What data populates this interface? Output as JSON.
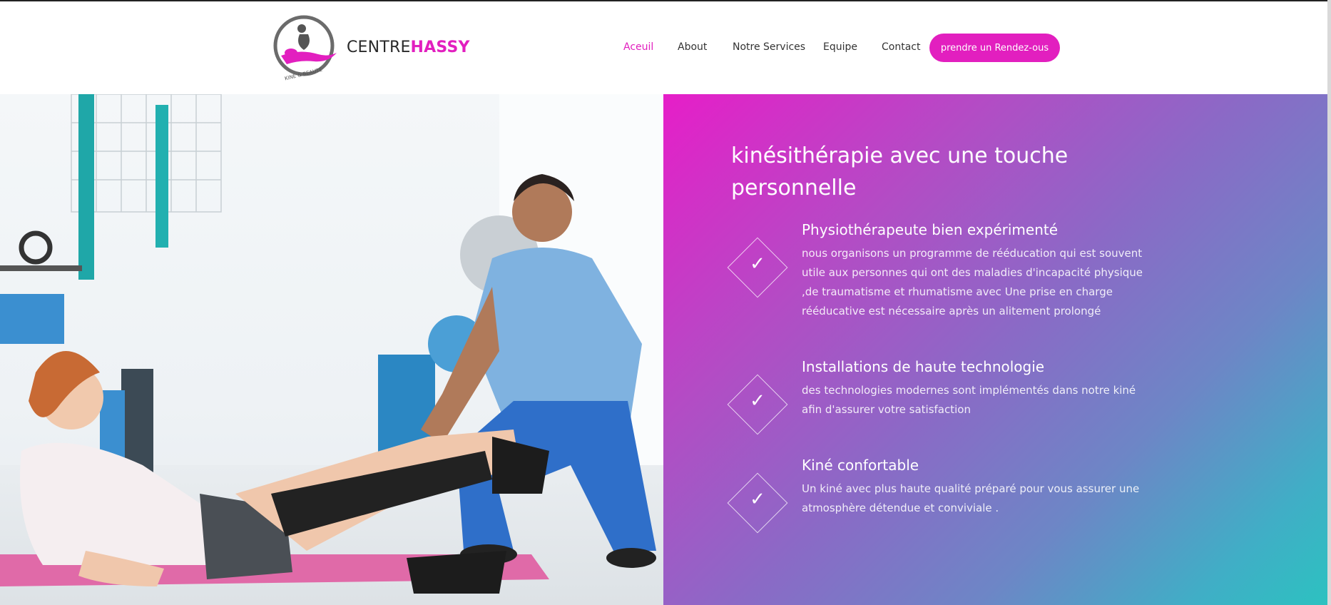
{
  "header": {
    "brand_part1": "CENTRE",
    "brand_part2": "HASSY",
    "logo_caption": "KINÉ & BEAUTÉ",
    "nav": [
      {
        "label": "Aceuil",
        "active": true
      },
      {
        "label": "About",
        "active": false
      },
      {
        "label": "Notre Services",
        "active": false
      },
      {
        "label": "Equipe",
        "active": false
      },
      {
        "label": "Contact",
        "active": false
      }
    ],
    "cta_label": "prendre un Rendez-ous",
    "accent_color": "#e21fbf"
  },
  "hero": {
    "title": "kinésithérapie avec une touche personnelle",
    "features": [
      {
        "icon": "check-icon",
        "title": "Physiothérapeute bien expérimenté",
        "text": "nous organisons un programme de rééducation qui est souvent utile aux personnes qui ont des maladies d'incapacité physique ,de traumatisme et rhumatisme avec Une prise en charge rééducative est nécessaire après un alitement prolongé"
      },
      {
        "icon": "check-icon",
        "title": "Installations de haute technologie",
        "text": "des technologies modernes sont implémentés dans notre kiné afin d'assurer votre satisfaction"
      },
      {
        "icon": "check-icon",
        "title": "Kiné confortable",
        "text": "Un kiné avec plus haute qualité préparé pour vous assurer une atmosphère détendue et conviviale ."
      }
    ],
    "gradient_colors": [
      "#e61ec8",
      "#8a6ac6",
      "#2cc2c0"
    ]
  }
}
